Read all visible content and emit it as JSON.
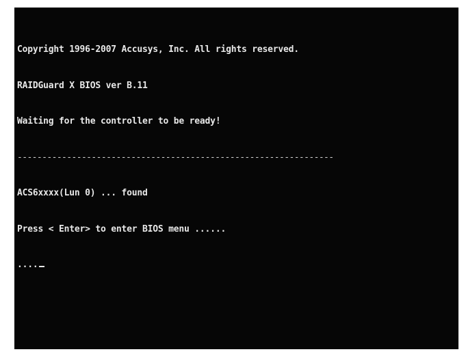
{
  "bios": {
    "copyright": "Copyright 1996-2007 Accusys, Inc. All rights reserved.",
    "version": "RAIDGuard X BIOS ver B.11",
    "waiting": "Waiting for the controller to be ready!",
    "divider": "----------------------------------------------------------------",
    "device_found": "ACS6xxxx(Lun 0) ... found",
    "prompt": "Press < Enter> to enter BIOS menu ......",
    "progress": "...."
  }
}
